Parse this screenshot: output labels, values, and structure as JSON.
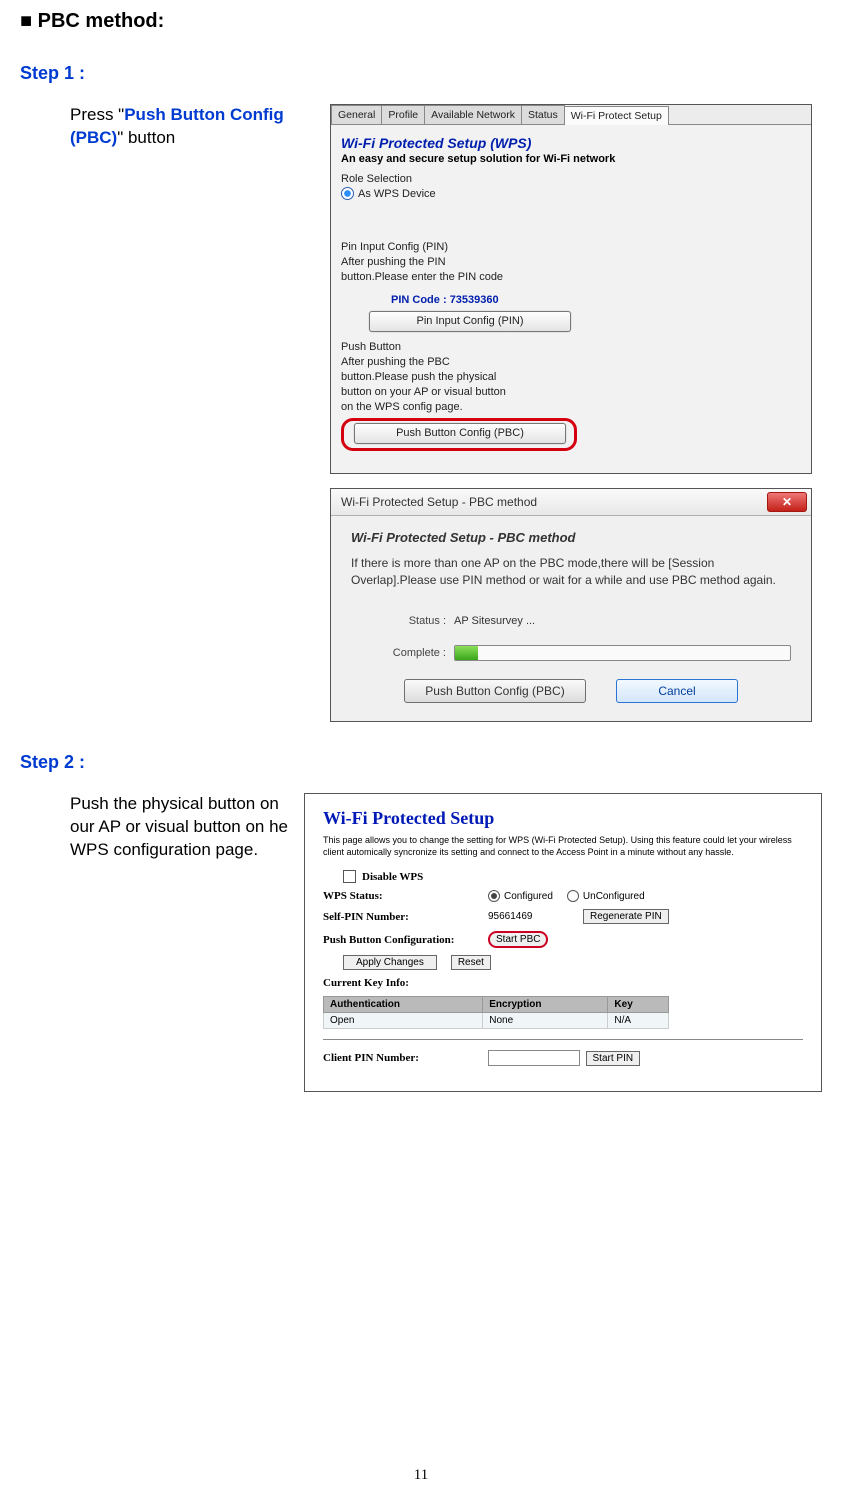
{
  "heading": "■ PBC method:",
  "step1_label": "Step 1 :",
  "step1_text_pre": "Press \"",
  "step1_text_emph": "Push Button Config (PBC)",
  "step1_text_post": "\" button",
  "step2_label": "Step 2 :",
  "step2_text": "Push the physical button on our AP or visual button on he WPS configuration page.",
  "page_num": "11",
  "tabs": {
    "general": "General",
    "profile": "Profile",
    "available": "Available Network",
    "status": "Status",
    "wps": "Wi-Fi Protect Setup"
  },
  "panel1": {
    "title": "Wi-Fi Protected Setup (WPS)",
    "subtitle": "An easy and secure setup solution for Wi-Fi network",
    "role_label": "Role Selection",
    "role_option": "As WPS Device",
    "pin_head": "Pin Input Config (PIN)",
    "pin_desc": "After pushing the PIN\nbutton.Please enter the PIN code",
    "pin_code_label": "PIN Code :",
    "pin_code_value": "73539360",
    "pin_button": "Pin Input Config (PIN)",
    "push_head": "Push Button",
    "push_desc": "After pushing the PBC\nbutton.Please push the physical\nbutton on your AP or visual button\non the WPS config page.",
    "pbc_button": "Push Button Config (PBC)"
  },
  "dialog": {
    "title": "Wi-Fi Protected Setup - PBC method",
    "heading": "Wi-Fi Protected Setup - PBC method",
    "message": "If there is more than one AP on the PBC mode,there will be [Session Overlap].Please use PIN method or wait for a while and use PBC method again.",
    "status_label": "Status :",
    "status_value": "AP Sitesurvey ...",
    "complete_label": "Complete :",
    "btn_pbc": "Push Button Config (PBC)",
    "btn_cancel": "Cancel"
  },
  "ap": {
    "title": "Wi-Fi Protected Setup",
    "desc": "This page allows you to change the setting for WPS (Wi-Fi Protected Setup). Using this feature could let your wireless client automically syncronize its setting and connect to the Access Point in a minute without any hassle.",
    "disable_wps": "Disable WPS",
    "wps_status_label": "WPS Status:",
    "wps_status_configured": "Configured",
    "wps_status_unconfigured": "UnConfigured",
    "self_pin_label": "Self-PIN Number:",
    "self_pin_value": "95661469",
    "regen_btn": "Regenerate PIN",
    "pbc_label": "Push Button Configuration:",
    "start_pbc": "Start PBC",
    "apply": "Apply Changes",
    "reset": "Reset",
    "cki_label": "Current Key Info:",
    "th_auth": "Authentication",
    "th_enc": "Encryption",
    "th_key": "Key",
    "td_auth": "Open",
    "td_enc": "None",
    "td_key": "N/A",
    "client_pin_label": "Client PIN Number:",
    "start_pin": "Start PIN"
  }
}
